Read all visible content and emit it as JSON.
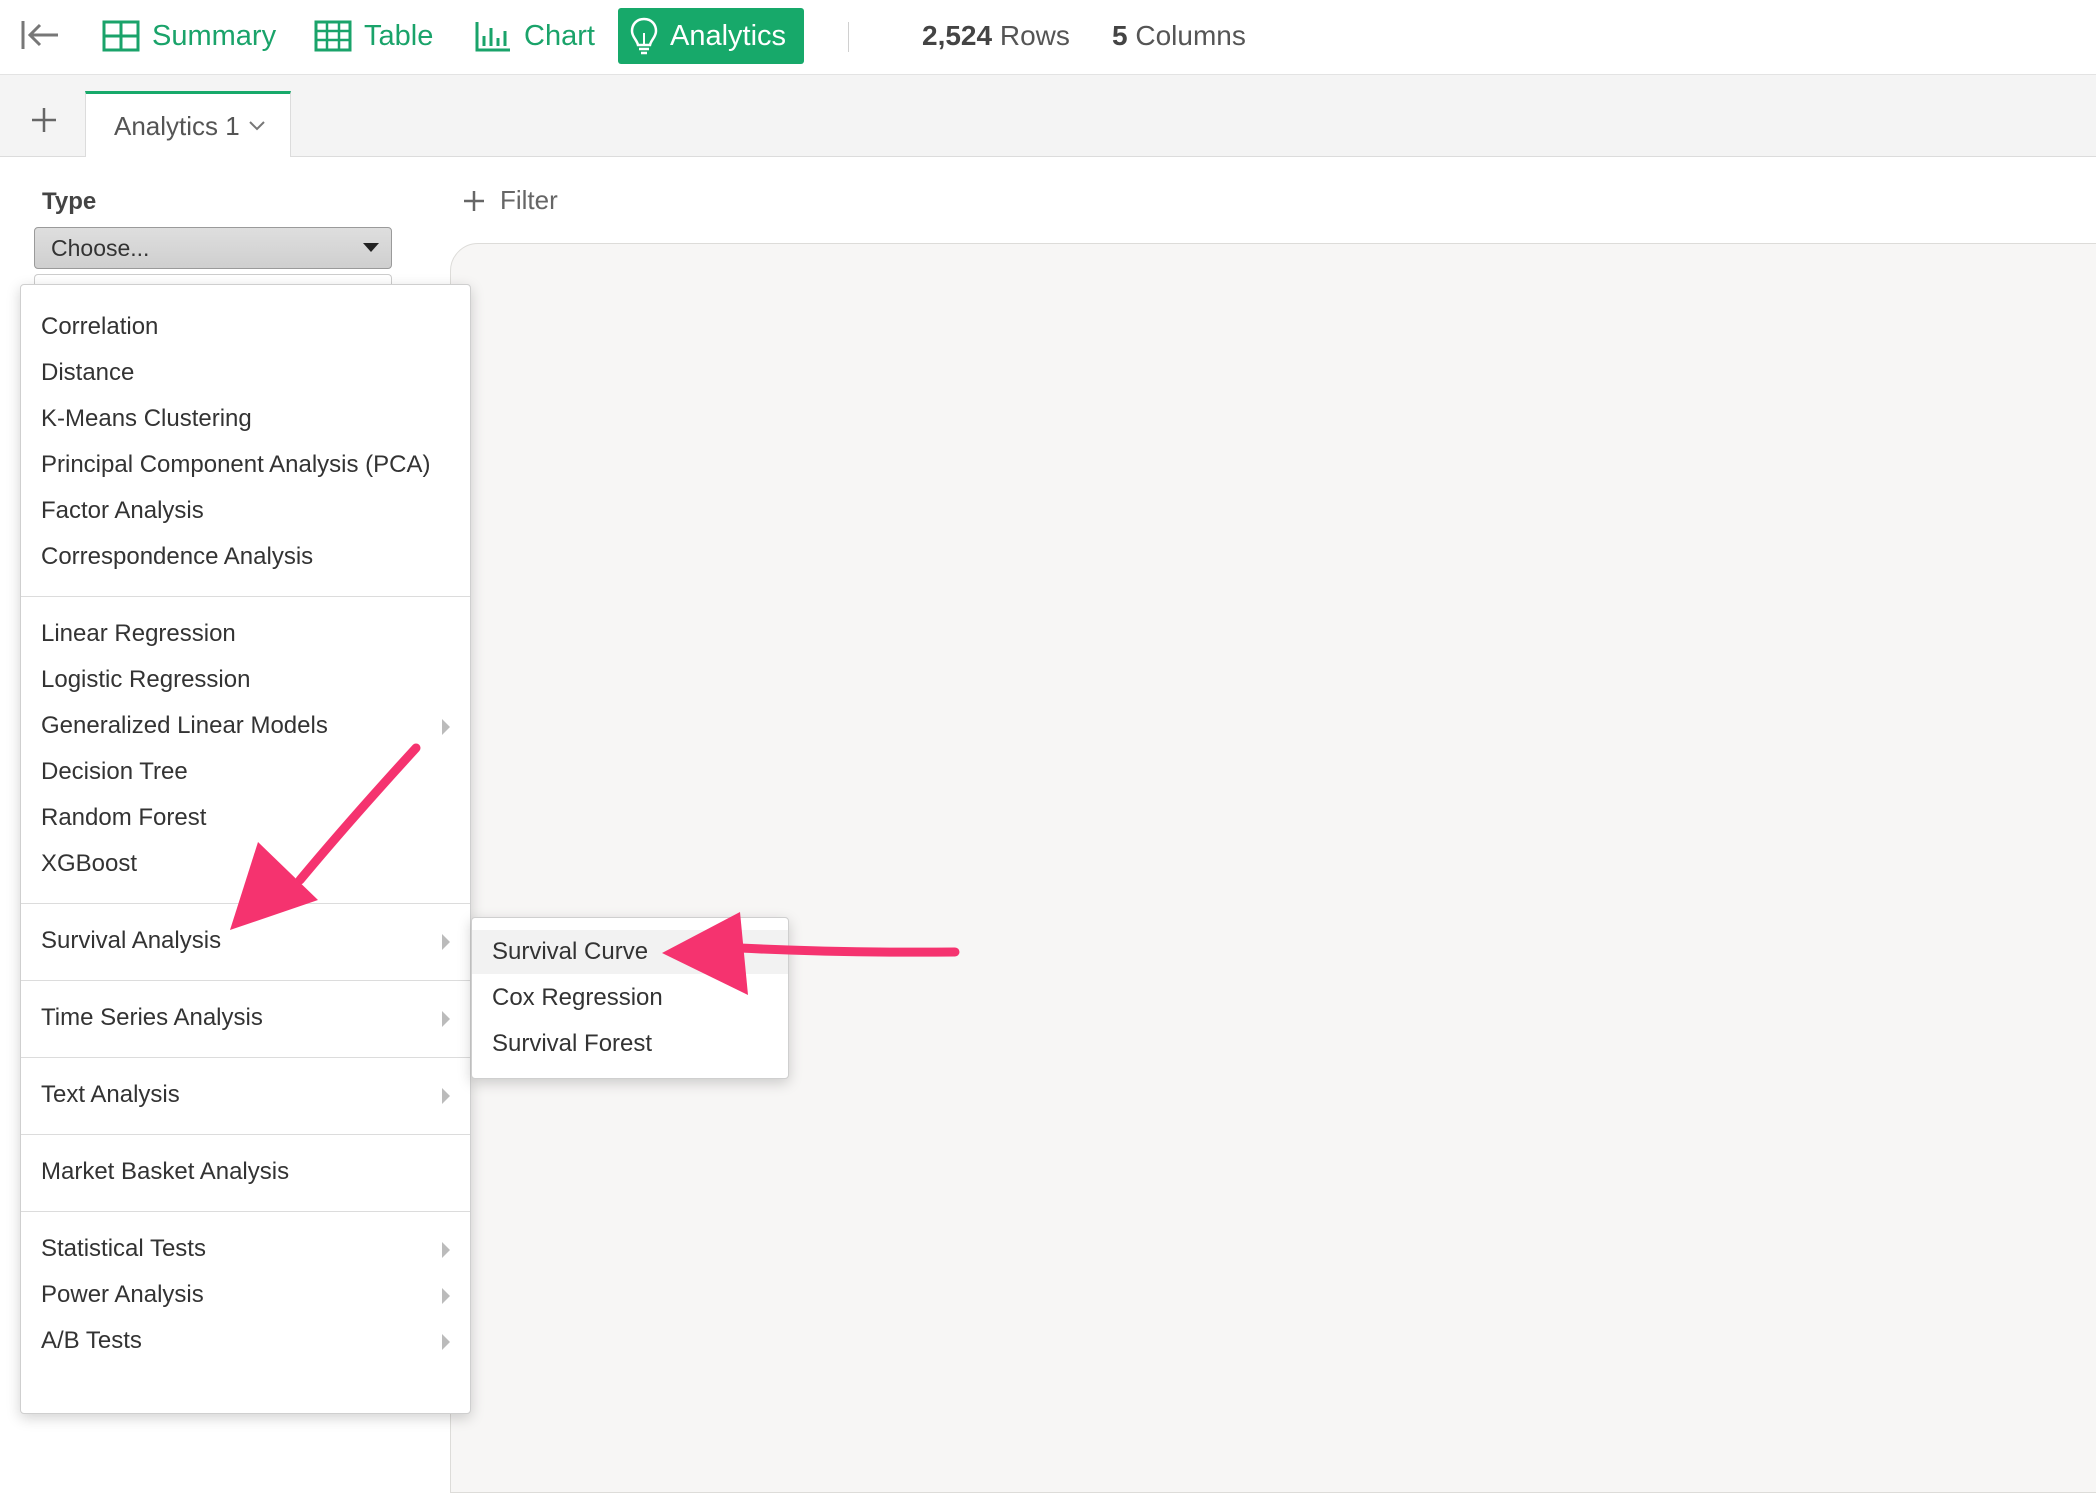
{
  "toolbar": {
    "tabs": [
      {
        "label": "Summary",
        "icon": "summary-grid-icon"
      },
      {
        "label": "Table",
        "icon": "table-icon"
      },
      {
        "label": "Chart",
        "icon": "bar-chart-icon"
      },
      {
        "label": "Analytics",
        "icon": "lightbulb-icon",
        "active": true
      }
    ],
    "rows_count": "2,524",
    "rows_label": "Rows",
    "cols_count": "5",
    "cols_label": "Columns",
    "accent_color": "#17a96a"
  },
  "tabstrip": {
    "tab_label": "Analytics 1"
  },
  "panel": {
    "type_label": "Type",
    "type_value": "Choose..."
  },
  "main": {
    "filter_label": "Filter"
  },
  "menu": {
    "groups": [
      [
        "Correlation",
        "Distance",
        "K-Means Clustering",
        "Principal Component Analysis (PCA)",
        "Factor Analysis",
        "Correspondence Analysis"
      ],
      [
        "Linear Regression",
        "Logistic Regression",
        "Generalized Linear Models",
        "Decision Tree",
        "Random Forest",
        "XGBoost"
      ],
      [
        "Survival Analysis"
      ],
      [
        "Time Series Analysis"
      ],
      [
        "Text Analysis"
      ],
      [
        "Market Basket Analysis"
      ],
      [
        "Statistical Tests",
        "Power Analysis",
        "A/B Tests"
      ]
    ],
    "submenu_items": [
      "Generalized Linear Models",
      "Survival Analysis",
      "Time Series Analysis",
      "Text Analysis",
      "Statistical Tests",
      "Power Analysis",
      "A/B Tests"
    ]
  },
  "submenu": {
    "items": [
      "Survival Curve",
      "Cox Regression",
      "Survival Forest"
    ],
    "highlighted": "Survival Curve"
  },
  "annotation": {
    "arrow_color": "#f5336f"
  }
}
